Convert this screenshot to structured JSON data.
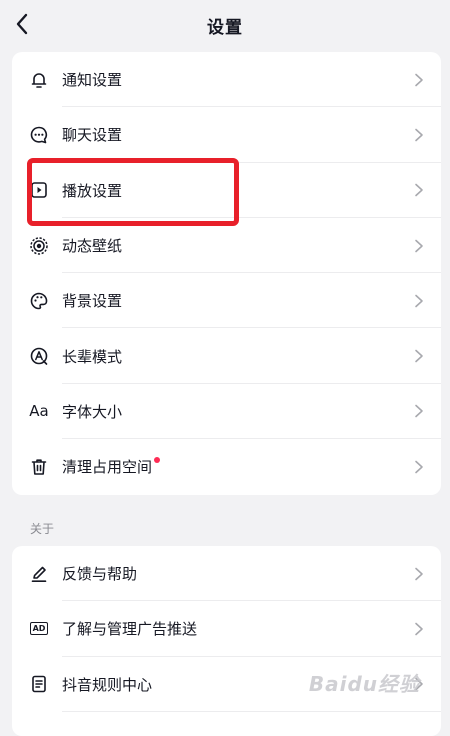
{
  "header": {
    "title": "设置"
  },
  "settings_items": [
    {
      "label": "通知设置",
      "icon": "bell-icon"
    },
    {
      "label": "聊天设置",
      "icon": "chat-bubble-icon"
    },
    {
      "label": "播放设置",
      "icon": "play-settings-icon"
    },
    {
      "label": "动态壁纸",
      "icon": "live-wallpaper-icon"
    },
    {
      "label": "背景设置",
      "icon": "palette-icon"
    },
    {
      "label": "长辈模式",
      "icon": "elder-mode-icon"
    },
    {
      "label": "字体大小",
      "icon": "font-size-icon",
      "glyph": "Aa"
    },
    {
      "label": "清理占用空间",
      "icon": "trash-icon",
      "badge": true
    }
  ],
  "about_section": {
    "title": "关于",
    "items": [
      {
        "label": "反馈与帮助",
        "icon": "edit-pen-icon"
      },
      {
        "label": "了解与管理广告推送",
        "icon": "ad-icon",
        "glyph": "AD"
      },
      {
        "label": "抖音规则中心",
        "icon": "rules-document-icon"
      }
    ]
  },
  "watermark": {
    "text": "Baidu经验"
  },
  "colors": {
    "accent_red": "#fe2c55",
    "highlight_red": "#e8202a",
    "background": "#f2f2f4"
  }
}
